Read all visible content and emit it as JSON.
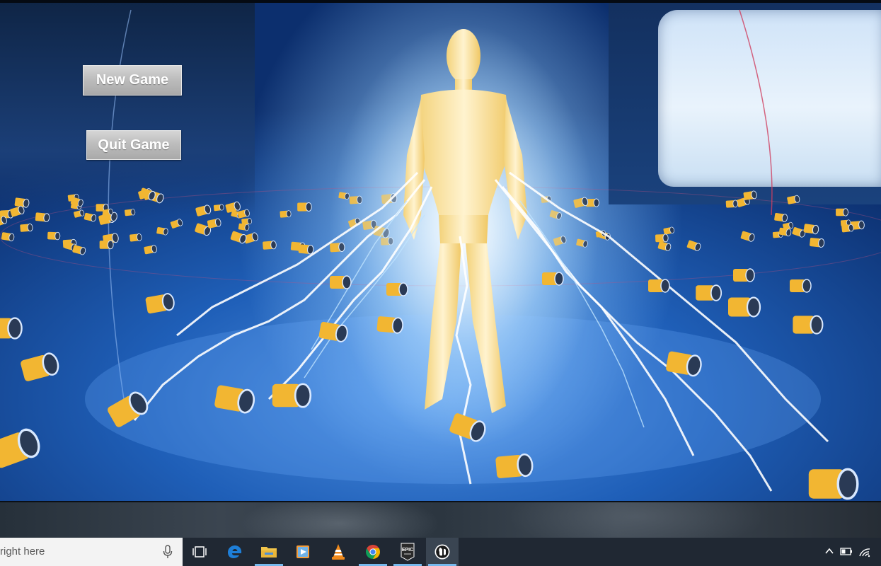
{
  "menu": {
    "new_game": "New Game",
    "quit_game": "Quit Game"
  },
  "taskbar": {
    "search_text": "right here",
    "icons": [
      {
        "name": "task-view-icon"
      },
      {
        "name": "edge-icon",
        "color": "#1e7fd8"
      },
      {
        "name": "file-explorer-icon",
        "color": "#f2c54b"
      },
      {
        "name": "media-player-icon",
        "color": "#f39c3b"
      },
      {
        "name": "vlc-icon",
        "color": "#f08a1c"
      },
      {
        "name": "chrome-icon"
      },
      {
        "name": "epic-games-icon",
        "label": "EPIC"
      },
      {
        "name": "unreal-engine-icon"
      }
    ],
    "tray": [
      "chevron-up-icon",
      "battery-icon",
      "wifi-icon"
    ]
  },
  "colors": {
    "scene_blue": "#1f5fb8",
    "capsule_yellow": "#f2b632",
    "taskbar_bg": "#202833",
    "running_indicator": "#76b9ed"
  }
}
